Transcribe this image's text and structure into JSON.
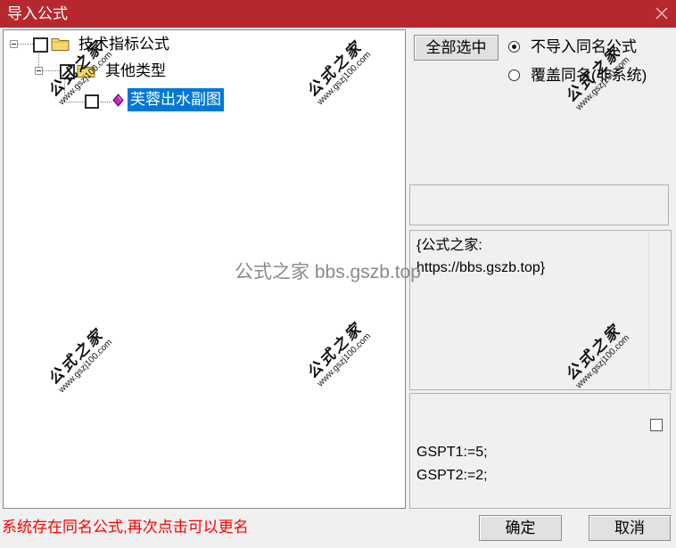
{
  "window": {
    "title": "导入公式",
    "close_icon": "close-icon"
  },
  "colors": {
    "title_bar": "#b7282e",
    "selection": "#0078d7",
    "status_text": "#ff0000",
    "dialog_bg": "#f0f0f0"
  },
  "tree": {
    "nodes": [
      {
        "label": "技术指标公式",
        "level": 0,
        "expanded": true,
        "checked": false,
        "icon": "folder-icon"
      },
      {
        "label": "其他类型",
        "level": 1,
        "expanded": true,
        "checked": false,
        "icon": "folder-icon"
      },
      {
        "label": "芙蓉出水副图",
        "level": 2,
        "checked": false,
        "selected": true,
        "icon": "formula-diamond-icon"
      }
    ]
  },
  "options": {
    "select_all_label": "全部选中",
    "radio": [
      {
        "label": "不导入同名公式",
        "selected": true
      },
      {
        "label": "覆盖同名(非系统)",
        "selected": false
      }
    ]
  },
  "name_field": {
    "value": ""
  },
  "description": {
    "lines": [
      "{公式之家:",
      "https://bbs.gszb.top}"
    ]
  },
  "code": {
    "checkbox_checked": false,
    "lines": [
      "GSPT1:=5;",
      "GSPT2:=2;"
    ]
  },
  "status_message": "系统存在同名公式,再次点击可以更名",
  "buttons": {
    "ok_label": "确定",
    "cancel_label": "取消"
  },
  "watermark": {
    "site_name": "公式之家",
    "site_url": "www.gszj100.com",
    "center_text": "公式之家 bbs.gszb.top"
  }
}
